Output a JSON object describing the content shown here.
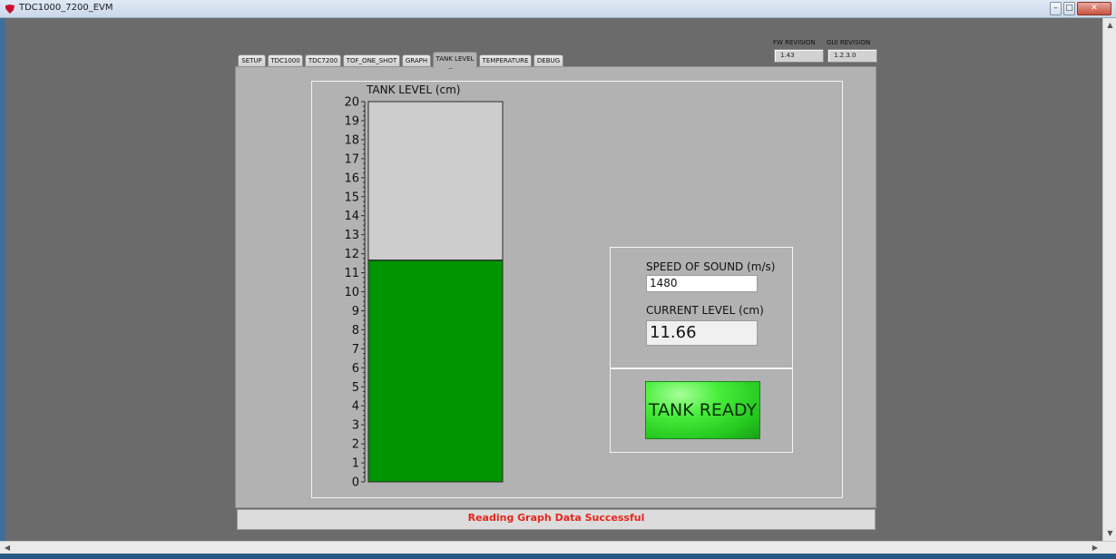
{
  "window": {
    "title": "TDC1000_7200_EVM",
    "minimize_glyph": "–",
    "maximize_glyph": "□",
    "close_glyph": "✕",
    "icon": "ti-logo-icon"
  },
  "revisions": {
    "fw_label": "FW REVISION",
    "fw_value": "1.43",
    "gui_label": "GUI REVISION",
    "gui_value": "1.2.3.0"
  },
  "tabs": [
    {
      "label": "SETUP",
      "active": false
    },
    {
      "label": "TDC1000",
      "active": false
    },
    {
      "label": "TDC7200",
      "active": false
    },
    {
      "label": "TOF_ONE_SHOT",
      "active": false
    },
    {
      "label": "GRAPH",
      "active": false
    },
    {
      "label": "TANK LEVEL",
      "active": true
    },
    {
      "label": "TEMPERATURE",
      "active": false
    },
    {
      "label": "DEBUG",
      "active": false
    }
  ],
  "tank": {
    "speed_label": "SPEED OF SOUND (m/s)",
    "speed_value": "1480",
    "level_label": "CURRENT LEVEL (cm)",
    "level_value": "11.66",
    "status_button": "TANK READY"
  },
  "status": {
    "message": "Reading Graph Data Successful"
  },
  "colors": {
    "fill": "#009400",
    "empty": "#cdcdcd",
    "status_text": "#e8261b",
    "button": "#33dd2a"
  },
  "chart_data": {
    "type": "bar",
    "title": "TANK LEVEL (cm)",
    "categories": [
      ""
    ],
    "values": [
      11.66
    ],
    "ylim": [
      0,
      20
    ],
    "yticks": [
      0,
      1,
      2,
      3,
      4,
      5,
      6,
      7,
      8,
      9,
      10,
      11,
      12,
      13,
      14,
      15,
      16,
      17,
      18,
      19,
      20
    ],
    "grid": false
  }
}
